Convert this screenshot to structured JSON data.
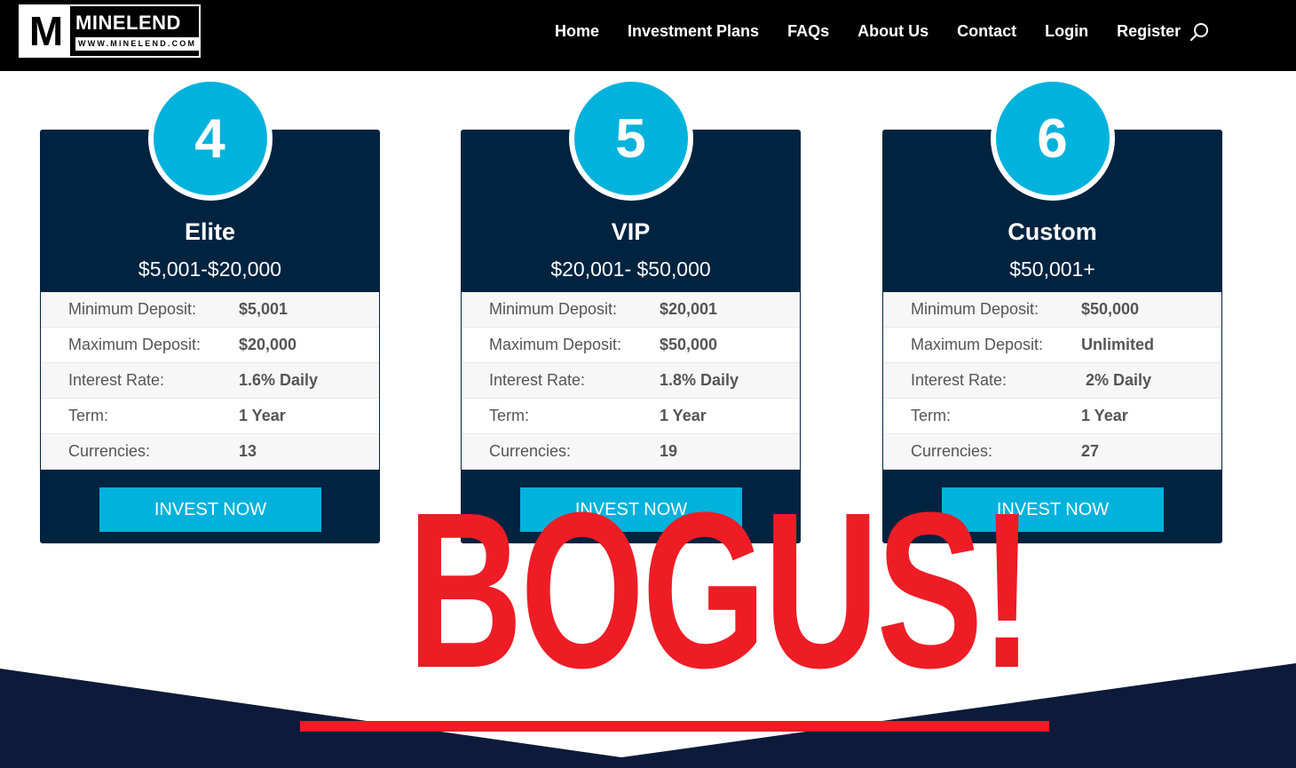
{
  "logo": {
    "mark": "M",
    "name": "MINELEND",
    "url": "WWW.MINELEND.COM"
  },
  "nav": {
    "items": [
      "Home",
      "Investment Plans",
      "FAQs",
      "About Us",
      "Contact",
      "Login",
      "Register"
    ],
    "search_icon": "search-icon"
  },
  "plans": [
    {
      "number": "4",
      "name": "Elite",
      "range": "$5,001-$20,000",
      "rows": [
        {
          "label": "Minimum Deposit:",
          "value": "$5,001"
        },
        {
          "label": "Maximum Deposit:",
          "value": "$20,000"
        },
        {
          "label": "Interest Rate:",
          "value": "1.6% Daily"
        },
        {
          "label": "Term:",
          "value": "1 Year"
        },
        {
          "label": "Currencies:",
          "value": "13"
        }
      ],
      "button": "INVEST NOW"
    },
    {
      "number": "5",
      "name": "VIP",
      "range": "$20,001- $50,000",
      "rows": [
        {
          "label": "Minimum Deposit:",
          "value": "$20,001"
        },
        {
          "label": "Maximum Deposit:",
          "value": "$50,000"
        },
        {
          "label": "Interest Rate:",
          "value": "1.8% Daily"
        },
        {
          "label": "Term:",
          "value": "1 Year"
        },
        {
          "label": "Currencies:",
          "value": "19"
        }
      ],
      "button": "INVEST NOW"
    },
    {
      "number": "6",
      "name": "Custom",
      "range": "$50,001+",
      "rows": [
        {
          "label": "Minimum Deposit:",
          "value": "$50,000"
        },
        {
          "label": "Maximum Deposit:",
          "value": "Unlimited"
        },
        {
          "label": "Interest Rate:",
          "value": " 2% Daily"
        },
        {
          "label": "Term:",
          "value": "1 Year"
        },
        {
          "label": "Currencies:",
          "value": "27"
        }
      ],
      "button": "INVEST NOW"
    }
  ],
  "overlay": {
    "text": "BOGUS!",
    "color": "#ee1c25"
  },
  "colors": {
    "card": "#002340",
    "accent": "#00b2dc",
    "nav": "#000000"
  }
}
